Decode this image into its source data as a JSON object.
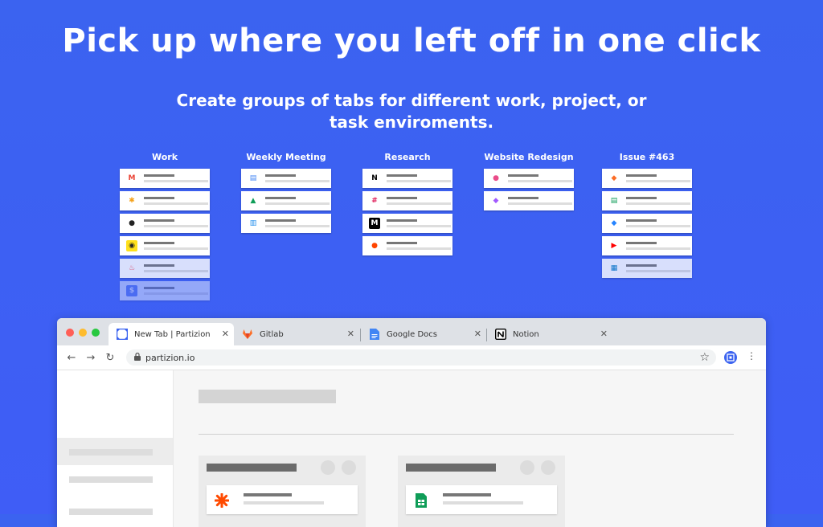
{
  "headline": "Pick up where you left off in one click",
  "subheadline": "Create groups of tabs for different work, project, or task enviroments.",
  "groups": [
    {
      "title": "Work",
      "tabs": [
        {
          "icon": "gmail-icon",
          "glyph": "M",
          "fg": "#ea4335",
          "bg": "#ffffff"
        },
        {
          "icon": "pinwheel-icon",
          "glyph": "✱",
          "fg": "#f4a11a",
          "bg": "#ffffff"
        },
        {
          "icon": "github-icon",
          "glyph": "●",
          "fg": "#222222",
          "bg": "#ffffff"
        },
        {
          "icon": "mailchimp-icon",
          "glyph": "◉",
          "fg": "#222222",
          "bg": "#ffe01b"
        },
        {
          "icon": "flame-icon",
          "glyph": "♨",
          "fg": "#ff5a5f",
          "bg": "#ffffff"
        },
        {
          "icon": "dollar-icon",
          "glyph": "$",
          "fg": "#ffffff",
          "bg": "#5b7cf0"
        }
      ]
    },
    {
      "title": "Weekly Meeting",
      "tabs": [
        {
          "icon": "google-docs-icon",
          "glyph": "▤",
          "fg": "#4285f4",
          "bg": "#ffffff"
        },
        {
          "icon": "google-drive-icon",
          "glyph": "▲",
          "fg": "#0f9d58",
          "bg": "#ffffff"
        },
        {
          "icon": "intercom-icon",
          "glyph": "▥",
          "fg": "#1f8ded",
          "bg": "#ffffff"
        }
      ]
    },
    {
      "title": "Research",
      "tabs": [
        {
          "icon": "notion-icon",
          "glyph": "N",
          "fg": "#000000",
          "bg": "#ffffff"
        },
        {
          "icon": "slack-icon",
          "glyph": "#",
          "fg": "#e01e5a",
          "bg": "#ffffff"
        },
        {
          "icon": "medium-icon",
          "glyph": "M",
          "fg": "#ffffff",
          "bg": "#000000"
        },
        {
          "icon": "reddit-icon",
          "glyph": "●",
          "fg": "#ff4500",
          "bg": "#ffffff"
        }
      ]
    },
    {
      "title": "Website Redesign",
      "tabs": [
        {
          "icon": "dribbble-icon",
          "glyph": "●",
          "fg": "#ea4c89",
          "bg": "#ffffff"
        },
        {
          "icon": "figma-icon",
          "glyph": "◆",
          "fg": "#a259ff",
          "bg": "#ffffff"
        }
      ]
    },
    {
      "title": "Issue #463",
      "tabs": [
        {
          "icon": "gitlab-icon",
          "glyph": "◆",
          "fg": "#fc6d26",
          "bg": "#ffffff"
        },
        {
          "icon": "google-sheets-icon",
          "glyph": "▤",
          "fg": "#0f9d58",
          "bg": "#ffffff"
        },
        {
          "icon": "jira-icon",
          "glyph": "◆",
          "fg": "#2684ff",
          "bg": "#ffffff"
        },
        {
          "icon": "youtube-icon",
          "glyph": "▶",
          "fg": "#ff0000",
          "bg": "#ffffff"
        },
        {
          "icon": "trello-icon",
          "glyph": "▦",
          "fg": "#0079bf",
          "bg": "#ffffff"
        }
      ]
    }
  ],
  "browser": {
    "tabs": [
      {
        "label": "New Tab | Partizion",
        "icon": "partizion-icon"
      },
      {
        "label": "Gitlab",
        "icon": "gitlab-icon"
      },
      {
        "label": "Google Docs",
        "icon": "google-docs-icon"
      },
      {
        "label": "Notion",
        "icon": "notion-icon"
      }
    ],
    "close_glyph": "✕",
    "url": "partizion.io",
    "back_glyph": "←",
    "forward_glyph": "→",
    "reload_glyph": "↻",
    "star_glyph": "☆",
    "menu_glyph": "⋮"
  },
  "colors": {
    "background": "#3f5df6",
    "traffic_red": "#ff5f57",
    "traffic_yellow": "#febc2e",
    "traffic_green": "#28c840"
  }
}
